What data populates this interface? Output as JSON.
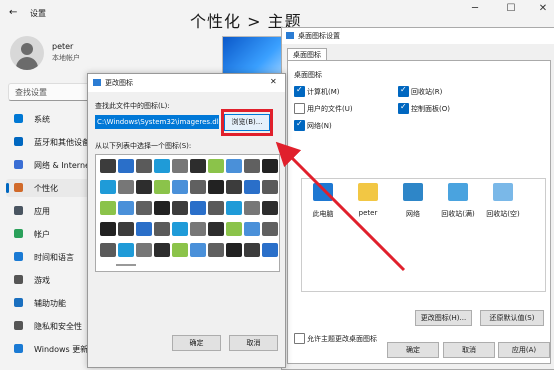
{
  "settings": {
    "title": "设置",
    "page_title": "个性化  >  主题",
    "user": {
      "name": "peter",
      "subtitle": "本地帐户"
    },
    "search_placeholder": "查找设置",
    "nav": [
      {
        "label": "系统",
        "icon": "monitor-icon",
        "color": "#0078d4"
      },
      {
        "label": "蓝牙和其他设备",
        "icon": "bluetooth-icon",
        "color": "#0067c0"
      },
      {
        "label": "网络 & Internet",
        "icon": "wifi-icon",
        "color": "#3a6ed4"
      },
      {
        "label": "个性化",
        "icon": "brush-icon",
        "color": "#d16a2a"
      },
      {
        "label": "应用",
        "icon": "apps-icon",
        "color": "#4a5561"
      },
      {
        "label": "帐户",
        "icon": "account-icon",
        "color": "#2aa05a"
      },
      {
        "label": "时间和语言",
        "icon": "globe-icon",
        "color": "#1a7ad4"
      },
      {
        "label": "游戏",
        "icon": "gamepad-icon",
        "color": "#555555"
      },
      {
        "label": "辅助功能",
        "icon": "accessibility-icon",
        "color": "#1a6fbf"
      },
      {
        "label": "隐私和安全性",
        "icon": "shield-icon",
        "color": "#555555"
      },
      {
        "label": "Windows 更新",
        "icon": "update-icon",
        "color": "#1a7ad4"
      }
    ],
    "window_controls": [
      "─",
      "☐",
      "✕"
    ]
  },
  "desktop_icons_dialog": {
    "title": "桌面图标设置",
    "tab": "桌面图标",
    "group_label": "桌面图标",
    "checkboxes": [
      {
        "label": "计算机(M)",
        "checked": true
      },
      {
        "label": "回收站(R)",
        "checked": true
      },
      {
        "label": "用户的文件(U)",
        "checked": false
      },
      {
        "label": "控制面板(O)",
        "checked": true
      },
      {
        "label": "网络(N)",
        "checked": true
      }
    ],
    "icons": [
      {
        "label": "此电脑",
        "icon": "computer-icon"
      },
      {
        "label": "peter",
        "icon": "folder-icon"
      },
      {
        "label": "网络",
        "icon": "network-icon"
      },
      {
        "label": "回收站(满)",
        "icon": "recycle-bin-full-icon"
      },
      {
        "label": "回收站(空)",
        "icon": "recycle-bin-empty-icon"
      }
    ],
    "change_icon_button": "更改图标(H)...",
    "restore_default_button": "还原默认值(S)",
    "allow_themes_label": "允许主题更改桌面图标",
    "ok": "确定",
    "cancel": "取消",
    "apply": "应用(A)"
  },
  "change_icon_dialog": {
    "title": "更改图标",
    "lookup_label": "查找此文件中的图标(L):",
    "path_value": "C:\\Windows\\System32\\imageres.dll",
    "browse": "浏览(B)...",
    "list_label": "从以下列表中选择一个图标(S):",
    "ok": "确定",
    "cancel": "取消",
    "close": "✕"
  },
  "colors": {
    "accent": "#0067c0",
    "highlight_red": "#e0202c",
    "selection": "#0078d7"
  }
}
